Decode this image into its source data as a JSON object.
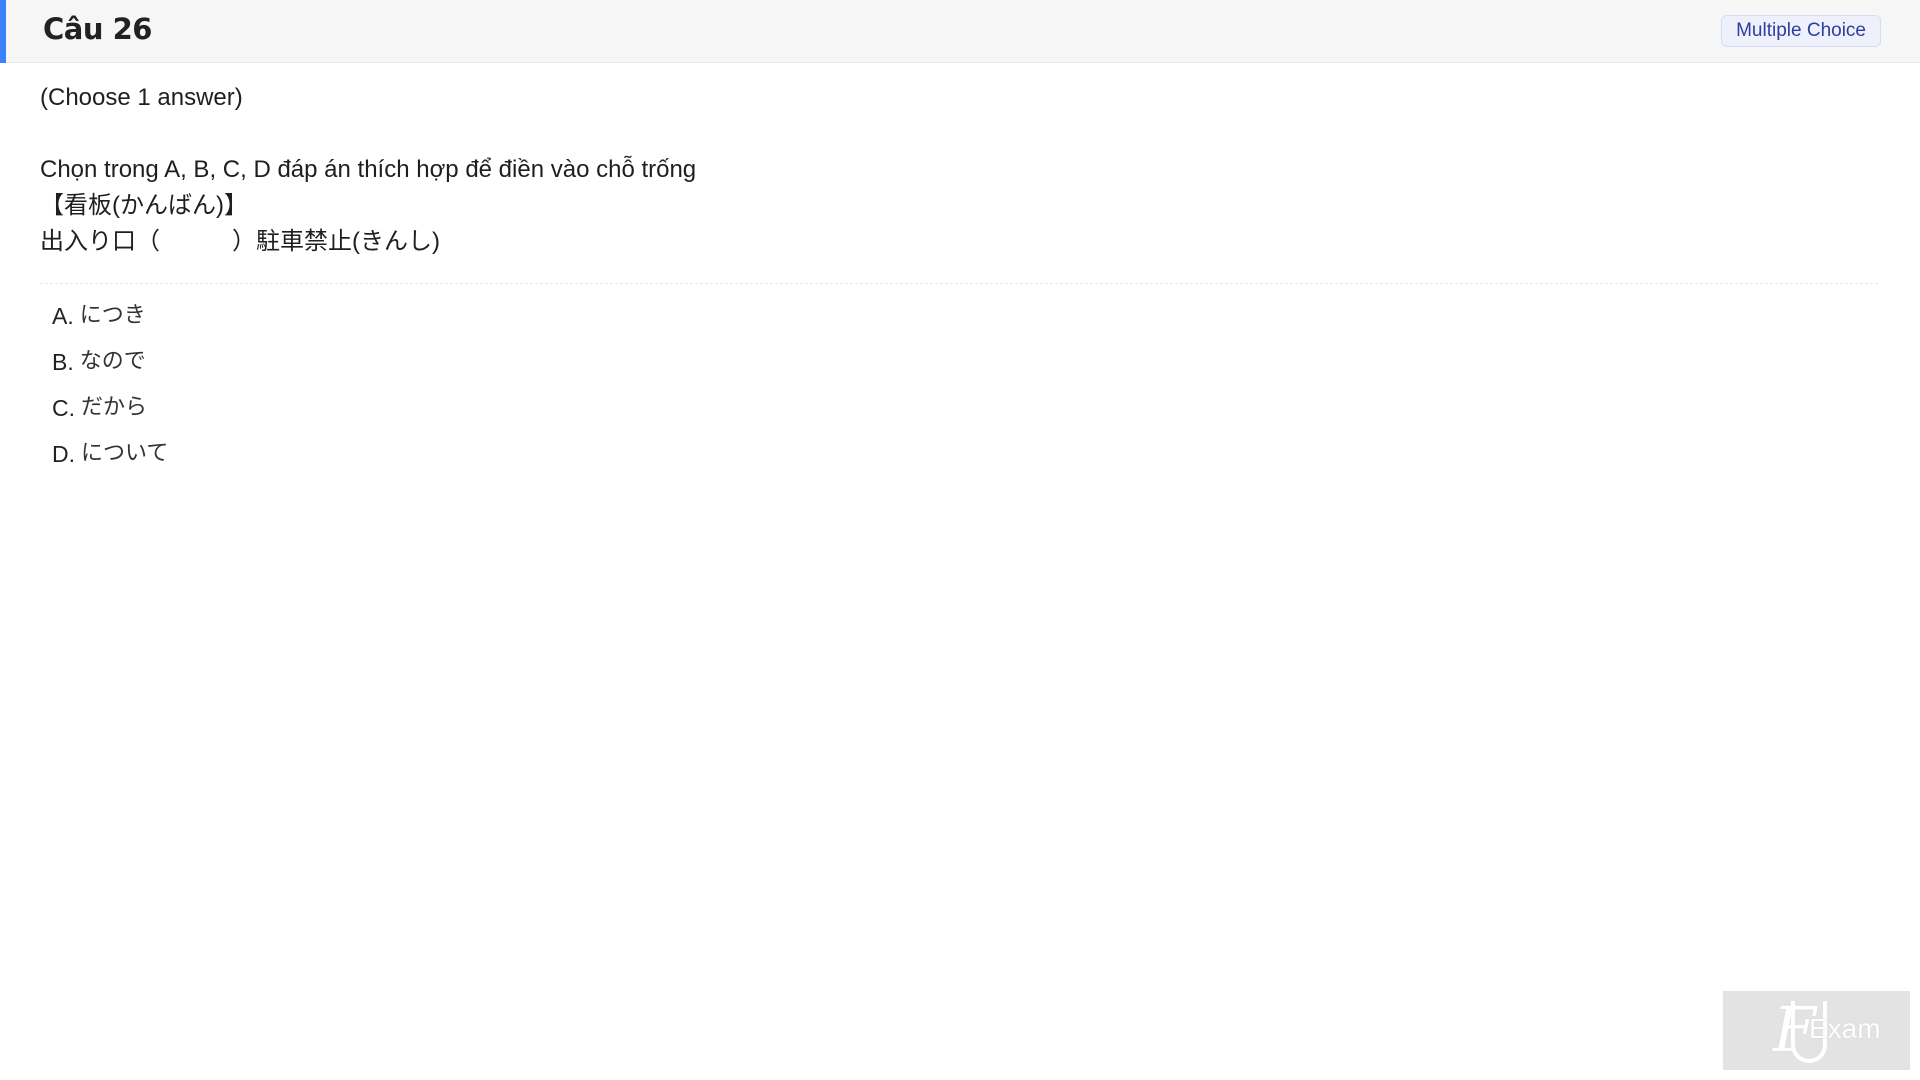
{
  "header": {
    "title": "Câu 26",
    "badge": "Multiple Choice"
  },
  "question": {
    "hint": "(Choose 1 answer)",
    "instruction": "Chọn trong A, B, C, D đáp án thích hợp để điền vào chỗ trống",
    "line1": "【看板(かんばん)】",
    "line2": "出入り口（　　　）駐車禁止(きんし)"
  },
  "options": [
    {
      "letter": "A.",
      "text": "につき"
    },
    {
      "letter": "B.",
      "text": "なので"
    },
    {
      "letter": "C.",
      "text": "だから"
    },
    {
      "letter": "D.",
      "text": "について"
    }
  ],
  "watermark": {
    "text": "Exam"
  },
  "colors": {
    "accent": "#3b82f6",
    "badge_text": "#2f3e9e",
    "header_bg": "#f6f6f6"
  }
}
